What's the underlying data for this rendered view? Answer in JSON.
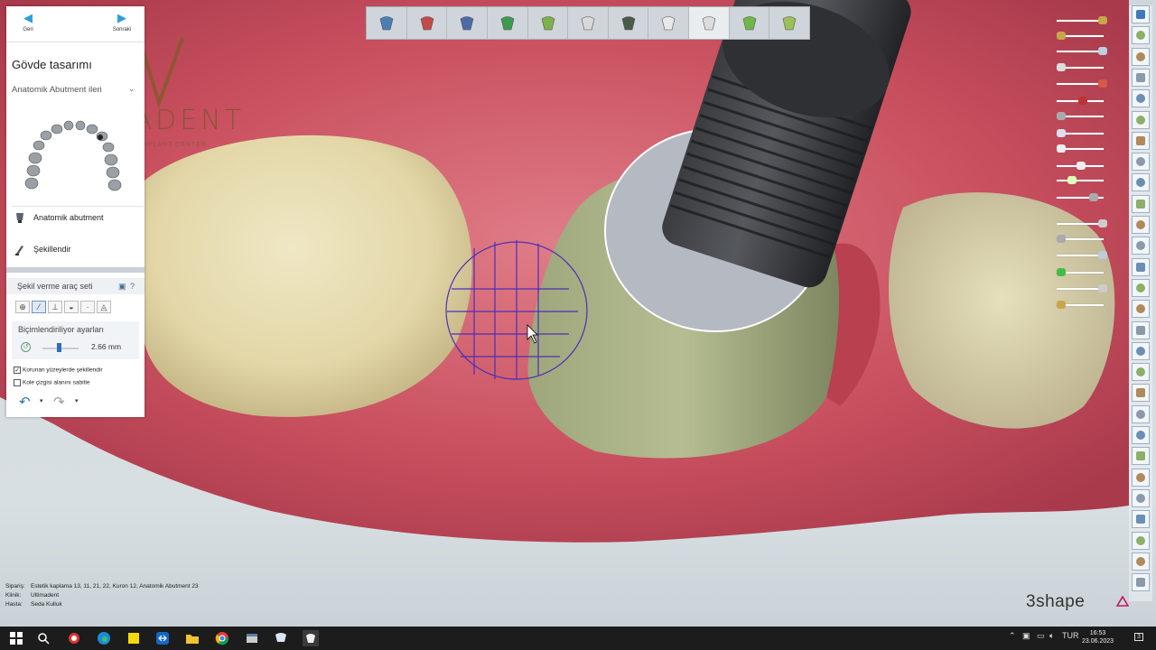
{
  "nav": {
    "back_label": "Geri",
    "next_label": "Sonraki"
  },
  "panel": {
    "title": "Gövde tasarımı",
    "subtitle": "Anatomik Abutment ileri",
    "items": [
      {
        "label": "Anatomik abutment"
      },
      {
        "label": "Şekillendir"
      }
    ]
  },
  "toolset": {
    "title": "Şekil verme araç seti",
    "settings_label": "Biçimlendiriliyor ayarları",
    "value": "2.66 mm",
    "checkbox1": "Korunan yüzeylerde şekillendir",
    "checkbox2": "Kole çizgisi alanını sabitle",
    "checkbox1_checked": true,
    "checkbox2_checked": false
  },
  "watermark": {
    "text": "ULTIMADENT",
    "sub": "DENTAL COSMETIC AND IMPLANT CENTER"
  },
  "toolbar": {
    "steps": [
      "scan-icon",
      "occlusion-icon",
      "implant-icon",
      "abutment-icon",
      "gingiva-icon",
      "crown-icon",
      "anatomy-icon",
      "tooth-icon",
      "shape-icon",
      "check-icon",
      "stack-icon"
    ],
    "active_index": 8
  },
  "info": {
    "order_key": "Sipariş:",
    "order_val": "Estetik kaplama 13, 11, 21, 22, Kuron 12, Anatomik Abutment 23",
    "clinic_key": "Klinik:",
    "clinic_val": "Ultimadent",
    "patient_key": "Hasta:",
    "patient_val": "Seda Kulluk"
  },
  "brand": {
    "name": "3shape"
  },
  "taskbar": {
    "lang": "TUR",
    "time": "16:53",
    "date": "23.06.2023",
    "notif": "3"
  },
  "colors": {
    "accent": "#2d9fd9",
    "gingiva": "#c8495a",
    "abutment": "#8f9a6e",
    "implant": "#2b2d30"
  }
}
